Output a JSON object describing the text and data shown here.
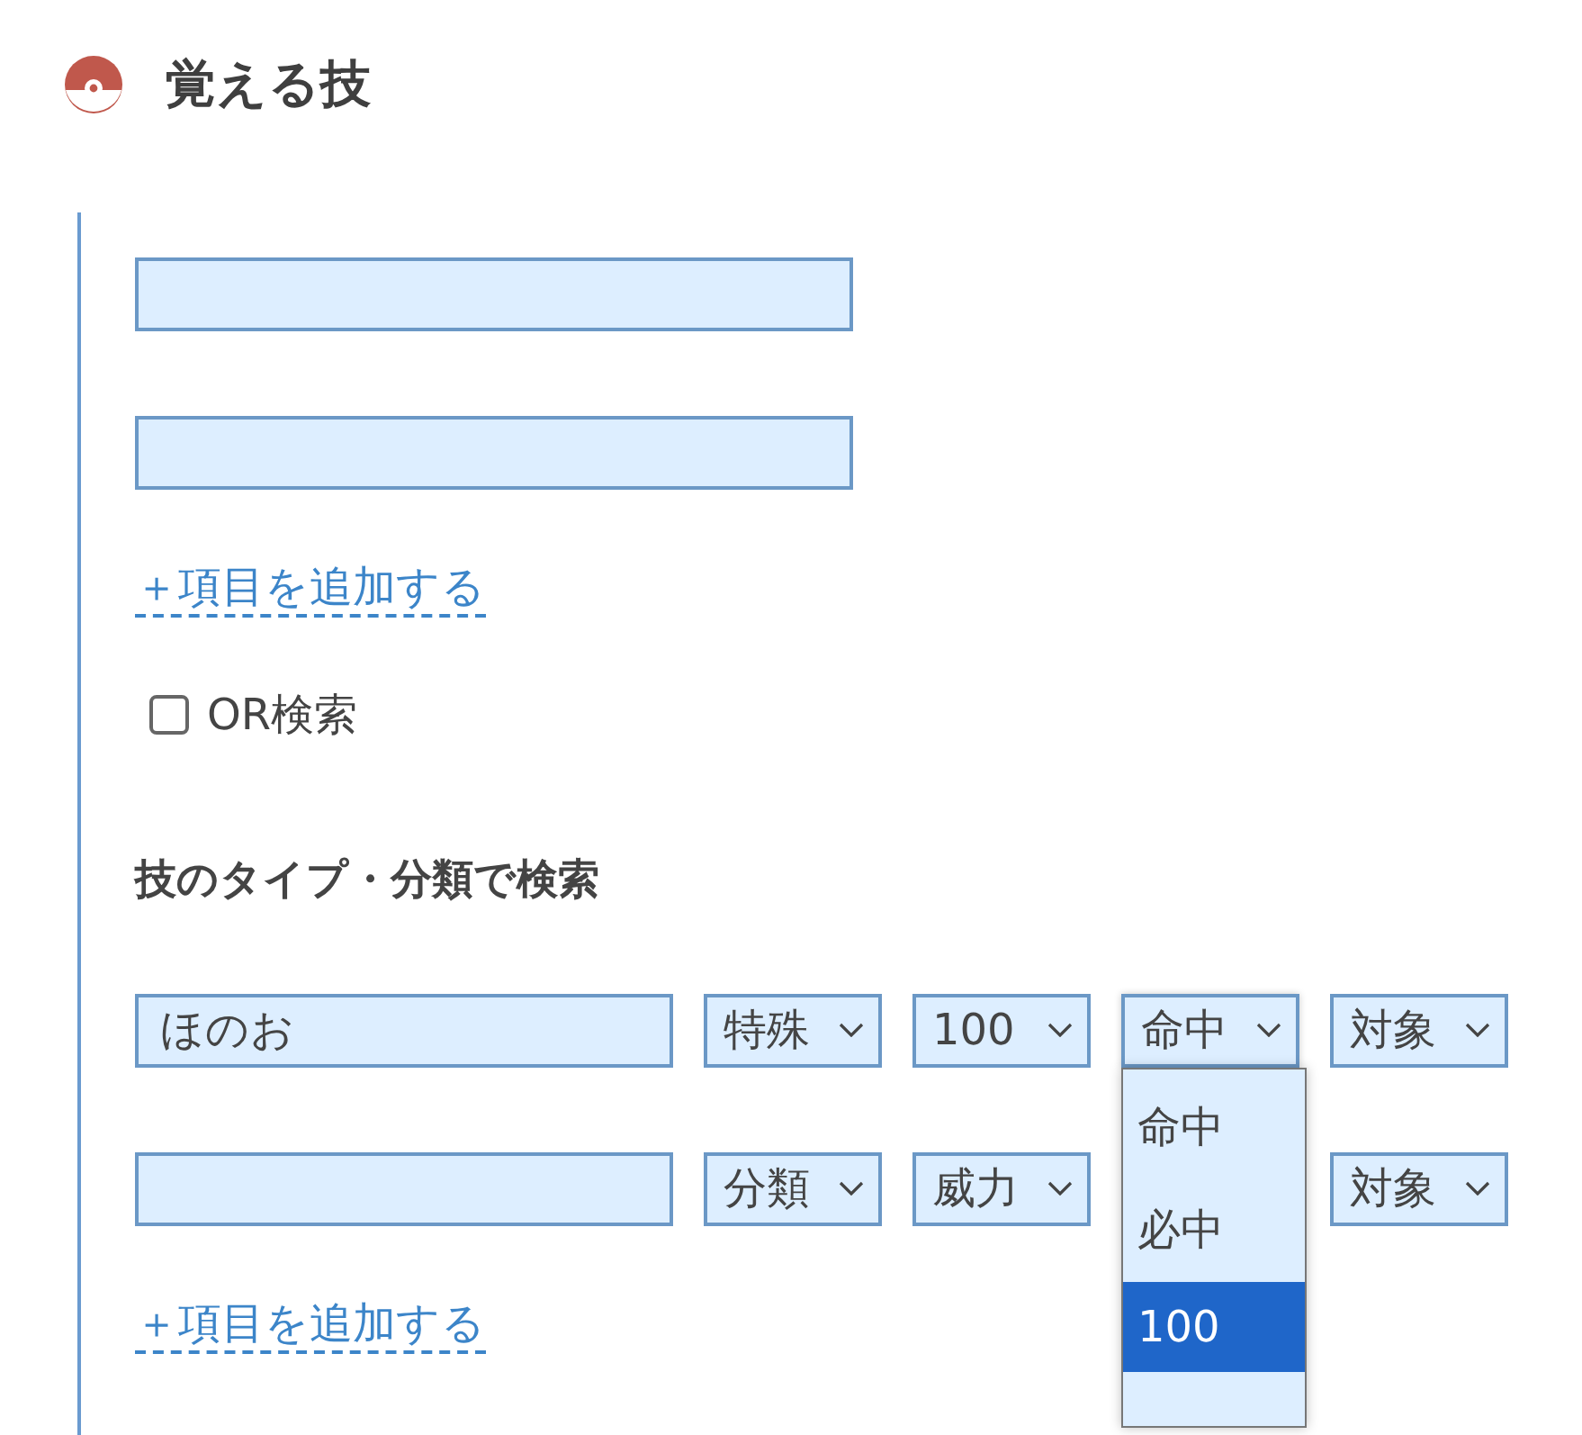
{
  "section": {
    "title": "覚える技"
  },
  "move_fields": [
    {
      "kind": "text"
    },
    {
      "kind": "text"
    }
  ],
  "move_add_link": "＋項目を追加する",
  "or_search": {
    "label": "OR検索",
    "checked": false
  },
  "type_search": {
    "title": "技のタイプ・分類で検索",
    "rows": [
      {
        "type_field": {
          "kind": "text",
          "value": "ほのお"
        },
        "selects": [
          {
            "label": "特殊"
          },
          {
            "label": "100"
          },
          {
            "label": "命中",
            "open": true,
            "options": [
              {
                "label": "命中",
                "selected": false
              },
              {
                "label": "必中",
                "selected": false
              },
              {
                "label": "100",
                "selected": true
              }
            ]
          },
          {
            "label": "対象"
          }
        ]
      },
      {
        "type_field": {
          "kind": "text"
        },
        "selects": [
          {
            "label": "分類"
          },
          {
            "label": "威力"
          },
          {
            "covered": true
          },
          {
            "label": "対象"
          }
        ]
      }
    ],
    "add_link": "＋項目を追加する"
  }
}
